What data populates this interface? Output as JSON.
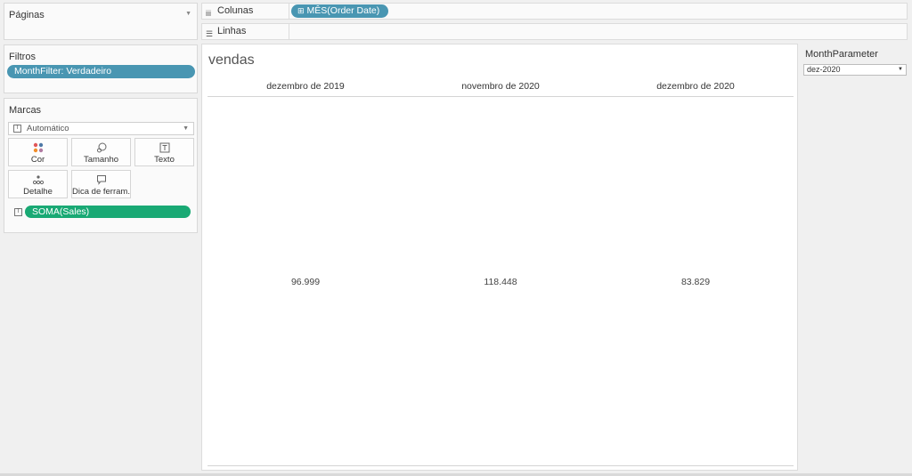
{
  "pages": {
    "title": "Páginas"
  },
  "filters": {
    "title": "Filtros",
    "pill": "MonthFilter: Verdadeiro"
  },
  "marks": {
    "title": "Marcas",
    "mark_type": "Automático",
    "buttons": {
      "cor": "Cor",
      "tamanho": "Tamanho",
      "texto": "Texto",
      "detalhe": "Detalhe",
      "dica": "Dica de ferram."
    },
    "field_pill": "SOMA(Sales)"
  },
  "shelves": {
    "columns": {
      "label": "Colunas",
      "pill": "MÊS(Order Date)"
    },
    "rows": {
      "label": "Linhas"
    }
  },
  "viz": {
    "title": "vendas",
    "columns": [
      "dezembro de 2019",
      "novembro de 2020",
      "dezembro de 2020"
    ],
    "values": [
      "96.999",
      "118.448",
      "83.829"
    ]
  },
  "parameter": {
    "title": "MonthParameter",
    "value": "dez-2020"
  },
  "colors": {
    "filter_pill": "#4996b2",
    "measure_pill": "#19a974"
  },
  "icons": {
    "columns_shelf": "columns-icon",
    "rows_shelf": "rows-icon",
    "cor": "color-dots-icon",
    "tamanho": "size-icon",
    "texto": "text-icon",
    "detalhe": "detail-icon",
    "dica": "tooltip-icon"
  }
}
